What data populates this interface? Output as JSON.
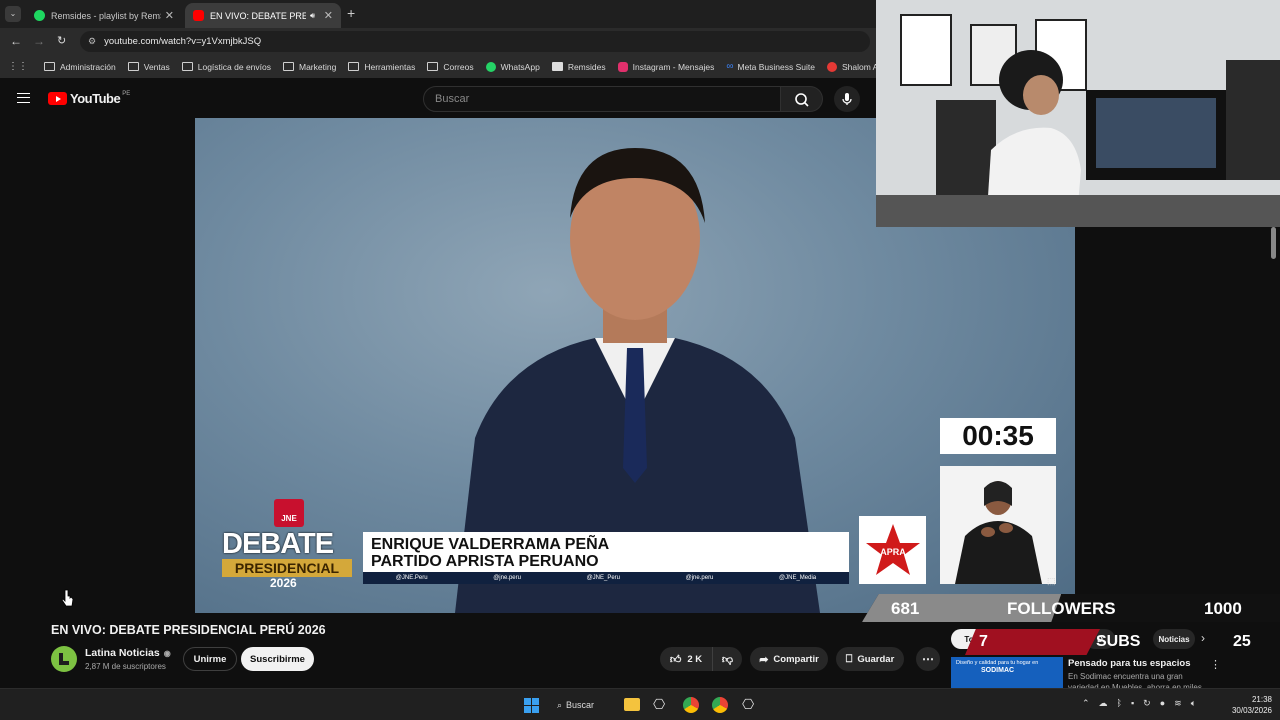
{
  "browser": {
    "tabs": [
      {
        "title": "Remsides - playlist by RemSide"
      },
      {
        "title": "EN VIVO: DEBATE PRESIDEN"
      }
    ],
    "url": "youtube.com/watch?v=y1VxmjbkJSQ",
    "bookmarks": [
      "Administración",
      "Ventas",
      "Logística de envíos",
      "Marketing",
      "Herramientas",
      "Correos",
      "WhatsApp",
      "Remsides",
      "Instagram - Mensajes",
      "Meta Business Suite",
      "Shalom Agencias"
    ]
  },
  "youtube": {
    "logo_text": "YouTube",
    "country": "PE",
    "search_placeholder": "Buscar"
  },
  "video": {
    "timer": "00:35",
    "debate_line1": "DEBATE",
    "debate_line2": "PRESIDENCIAL",
    "debate_year": "2026",
    "jne": "JNE",
    "candidate_name": "ENRIQUE VALDERRAMA PEÑA",
    "candidate_party": "PARTIDO APRISTA PERUANO",
    "party_logo_text": "APRA",
    "socials": [
      "@JNE.Peru",
      "@jne.peru",
      "@JNE_Peru",
      "@jne.peru",
      "@JNE_Media"
    ]
  },
  "stream_overlay": {
    "followers_current": "681",
    "followers_label": "FOLLOWERS",
    "followers_goal": "1000",
    "followers_progress": 0.681,
    "subs_current": "7",
    "subs_label": "SUBS",
    "subs_goal": "25"
  },
  "info": {
    "title": "EN VIVO: DEBATE PRESIDENCIAL PERÚ 2026",
    "channel": "Latina Noticias",
    "subscribers": "2,87 M de suscriptores",
    "join_label": "Unirme",
    "subscribe_label": "Suscribirme",
    "likes": "2 K",
    "share_label": "Compartir",
    "save_label": "Guardar",
    "chips": [
      "To",
      "icias",
      "D",
      "Noticias"
    ]
  },
  "ad": {
    "banner_text": "Diseño y calidad para tu hogar en",
    "banner_brand": "SODIMAC",
    "title": "Pensado para tus espacios",
    "desc": "En Sodimac encuentra una gran variedad en Muebles, ahorra en miles"
  },
  "taskbar": {
    "search_label": "Buscar",
    "time": "21:38",
    "date": "30/03/2026"
  }
}
